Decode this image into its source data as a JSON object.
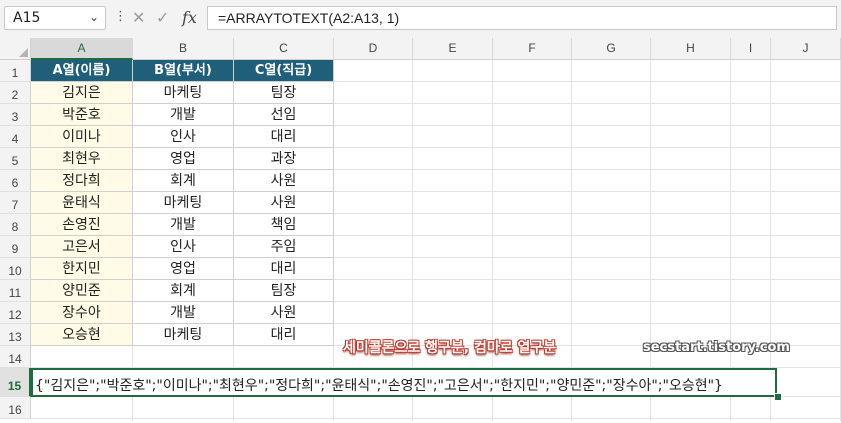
{
  "formula_bar": {
    "name_box": "A15",
    "cancel_icon": "✕",
    "enter_icon": "✓",
    "fx_label": "fx",
    "formula": "=ARRAYTOTEXT(A2:A13, 1)"
  },
  "columns": [
    "A",
    "B",
    "C",
    "D",
    "E",
    "F",
    "G",
    "H",
    "I",
    "J"
  ],
  "rows": [
    "1",
    "2",
    "3",
    "4",
    "5",
    "6",
    "7",
    "8",
    "9",
    "10",
    "11",
    "12",
    "13",
    "14",
    "15",
    "16"
  ],
  "table": {
    "headers": [
      "A열(이름)",
      "B열(부서)",
      "C열(직급)"
    ],
    "rows": [
      [
        "김지은",
        "마케팅",
        "팀장"
      ],
      [
        "박준호",
        "개발",
        "선임"
      ],
      [
        "이미나",
        "인사",
        "대리"
      ],
      [
        "최현우",
        "영업",
        "과장"
      ],
      [
        "정다희",
        "회계",
        "사원"
      ],
      [
        "윤태식",
        "마케팅",
        "사원"
      ],
      [
        "손영진",
        "개발",
        "책임"
      ],
      [
        "고은서",
        "인사",
        "주임"
      ],
      [
        "한지민",
        "영업",
        "대리"
      ],
      [
        "양민준",
        "회계",
        "팀장"
      ],
      [
        "장수아",
        "개발",
        "사원"
      ],
      [
        "오승현",
        "마케팅",
        "대리"
      ]
    ]
  },
  "annotation": "세미콜론으로 행구분, 컴마로 열구분",
  "watermark": "secstart.tistory.com",
  "result": "{\"김지은\";\"박준호\";\"이미나\";\"최현우\";\"정다희\";\"윤태식\";\"손영진\";\"고은서\";\"한지민\";\"양민준\";\"장수아\";\"오승현\"}",
  "colors": {
    "header_fill": "#1f5f7a",
    "name_fill": "#fffbe6",
    "selection": "#1e6b3e"
  }
}
